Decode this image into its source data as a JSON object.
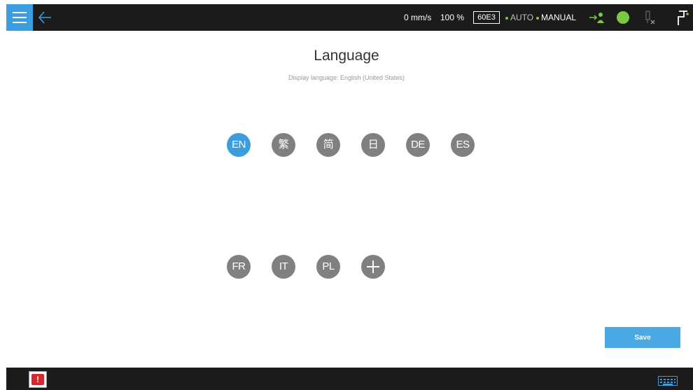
{
  "header": {
    "speed": "0 mm/s",
    "speed_percent": "100 %",
    "robot_id": "60E3",
    "mode_auto": "AUTO",
    "mode_manual": "MANUAL"
  },
  "page": {
    "title": "Language",
    "subtitle": "Display language: English (United States)"
  },
  "languages": [
    {
      "label": "EN",
      "selected": true
    },
    {
      "label": "繁",
      "selected": false
    },
    {
      "label": "简",
      "selected": false
    },
    {
      "label": "日",
      "selected": false
    },
    {
      "label": "DE",
      "selected": false
    },
    {
      "label": "ES",
      "selected": false
    },
    {
      "label": "FR",
      "selected": false
    },
    {
      "label": "IT",
      "selected": false
    },
    {
      "label": "PL",
      "selected": false
    }
  ],
  "actions": {
    "save_label": "Save"
  },
  "alert": {
    "symbol": "!"
  },
  "colors": {
    "accent": "#3b9ddd",
    "bar": "#1b1b1b",
    "lang_unselected": "#808080",
    "status_green": "#7ac943",
    "alert_red": "#d9272e"
  }
}
